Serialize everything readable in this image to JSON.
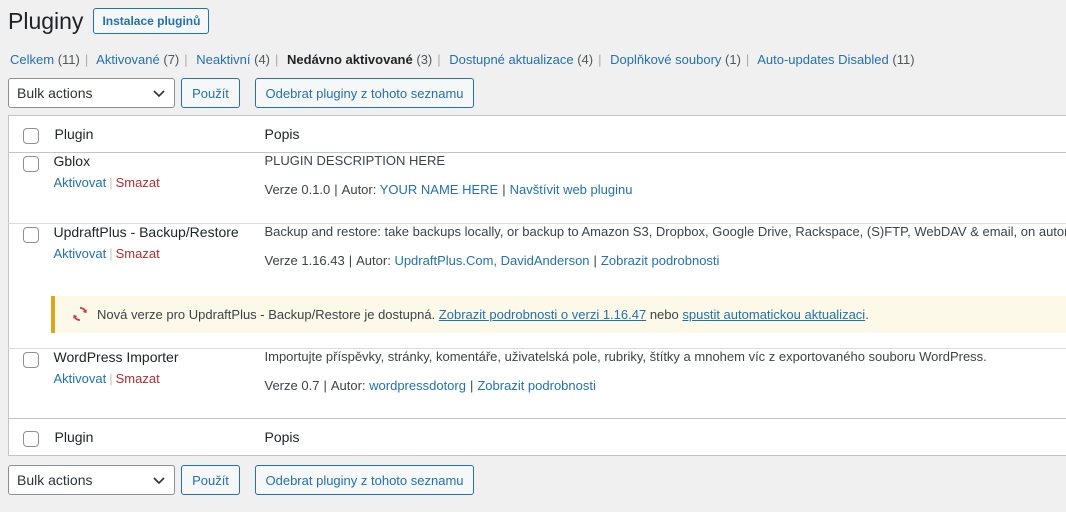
{
  "header": {
    "title": "Pluginy",
    "add_button": "Instalace pluginů"
  },
  "filters": [
    {
      "label": "Celkem",
      "count": "(11)"
    },
    {
      "label": "Aktivované",
      "count": "(7)"
    },
    {
      "label": "Neaktivní",
      "count": "(4)"
    },
    {
      "label": "Nedávno aktivované",
      "count": "(3)"
    },
    {
      "label": "Dostupné aktualizace",
      "count": "(4)"
    },
    {
      "label": "Doplňkové soubory",
      "count": "(1)"
    },
    {
      "label": "Auto-updates Disabled",
      "count": "(11)"
    }
  ],
  "tablenav": {
    "bulk_select": "Bulk actions",
    "apply_button": "Použít",
    "remove_button": "Odebrat pluginy z tohoto seznamu"
  },
  "columns": {
    "plugin": "Plugin",
    "description": "Popis"
  },
  "plugins": [
    {
      "name": "Gblox",
      "activate": "Aktivovat",
      "delete": "Smazat",
      "description": "PLUGIN DESCRIPTION HERE",
      "version": "Verze 0.1.0",
      "author_label": "Autor:",
      "author": "YOUR NAME HERE",
      "link": "Navštívit web pluginu"
    },
    {
      "name": "UpdraftPlus - Backup/Restore",
      "activate": "Aktivovat",
      "delete": "Smazat",
      "description": "Backup and restore: take backups locally, or backup to Amazon S3, Dropbox, Google Drive, Rackspace, (S)FTP, WebDAV & email, on automatic schedules.",
      "version": "Verze 1.16.43",
      "author_label": "Autor:",
      "author": "UpdraftPlus.Com, DavidAnderson",
      "link": "Zobrazit podrobnosti"
    },
    {
      "name": "WordPress Importer",
      "activate": "Aktivovat",
      "delete": "Smazat",
      "description": "Importujte příspěvky, stránky, komentáře, uživatelská pole, rubriky, štítky a mnohem víc z exportovaného souboru WordPress.",
      "version": "Verze 0.7",
      "author_label": "Autor:",
      "author": "wordpressdotorg",
      "link": "Zobrazit podrobnosti"
    }
  ],
  "update_notice": {
    "text": "Nová verze pro UpdraftPlus - Backup/Restore je dostupná.",
    "details_link": "Zobrazit podrobnosti o verzi 1.16.47",
    "or": "nebo",
    "update_link": "spustit automatickou aktualizaci",
    "end": ".",
    "icon": "update-icon"
  },
  "colors": {
    "link": "#2271b1",
    "delete": "#b32d2e",
    "notice_border": "#dba617",
    "notice_bg": "#fcf9e8",
    "update_icon": "#d63638"
  }
}
